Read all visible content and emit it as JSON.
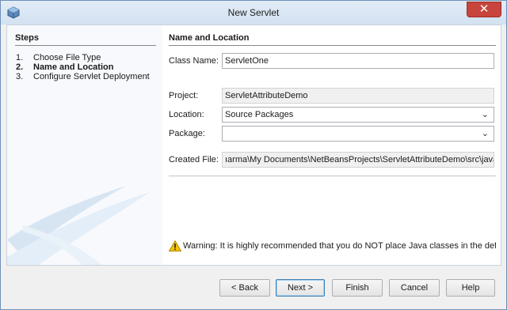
{
  "window": {
    "title": "New Servlet",
    "close_label": "✕"
  },
  "steps": {
    "heading": "Steps",
    "items": [
      {
        "num": "1.",
        "label": "Choose File Type"
      },
      {
        "num": "2.",
        "label": "Name and Location"
      },
      {
        "num": "3.",
        "label": "Configure Servlet Deployment"
      }
    ],
    "active_index": 1
  },
  "panel": {
    "heading": "Name and Location",
    "class_name": {
      "label": "Class Name:",
      "value": "ServletOne"
    },
    "project": {
      "label": "Project:",
      "value": "ServletAttributeDemo"
    },
    "location": {
      "label": "Location:",
      "value": "Source Packages"
    },
    "package": {
      "label": "Package:",
      "value": ""
    },
    "created_file": {
      "label": "Created File:",
      "value": "ıarma\\My Documents\\NetBeansProjects\\ServletAttributeDemo\\src\\java\\"
    },
    "warning": "Warning: It is highly recommended that you do NOT place Java classes in the defau"
  },
  "buttons": {
    "back": "< Back",
    "next": "Next >",
    "finish": "Finish",
    "cancel": "Cancel",
    "help": "Help"
  },
  "icons": {
    "app": "netbeans-cube-icon",
    "warning": "warning-triangle-icon",
    "chevron": "chevron-down-icon"
  },
  "colors": {
    "close": "#c7453c",
    "warning": "#f5c300",
    "default_button_border": "#3c7fb1"
  }
}
